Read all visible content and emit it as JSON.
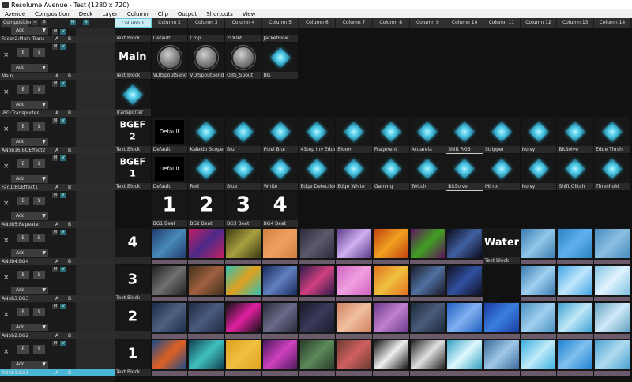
{
  "title": "Resolume Avenue - Test (1280 x 720)",
  "menu": [
    "Avenue",
    "Composition",
    "Deck",
    "Layer",
    "Column",
    "Clip",
    "Output",
    "Shortcuts",
    "View"
  ],
  "header": {
    "composition_label": "Composition",
    "x": "×",
    "b": "B",
    "m": "M",
    "s": "S"
  },
  "columns": [
    "Column 1",
    "Column 2",
    "Column 3",
    "Column 4",
    "Column 5",
    "Column 6",
    "Column 7",
    "Column 8",
    "Column 9",
    "Column 10",
    "Column 11",
    "Column 12",
    "Column 13",
    "Column 14"
  ],
  "active_column": 0,
  "layers": [
    {
      "name": "Fader2:Main Trans",
      "add": "Add"
    },
    {
      "name": "Main",
      "add": "Add"
    },
    {
      "name": "-BG:Transporter-",
      "add": "Add"
    },
    {
      "name": "ANob16:BGEffect2",
      "add": "Add"
    },
    {
      "name": "Fad1:BGEffect1",
      "add": "Add"
    },
    {
      "name": "ANob5:Repeater",
      "add": "Add"
    },
    {
      "name": "ANob4:BG4",
      "add": "Add"
    },
    {
      "name": "ANob3:BG3",
      "add": "Add"
    },
    {
      "name": "ANob2:BG2",
      "add": "Add"
    },
    {
      "name": "ANob1:BG1",
      "add": "Add"
    }
  ],
  "button_labels": {
    "x": "×",
    "b": "B",
    "s": "S",
    "a": "A",
    "bb": "B",
    "m": "M",
    "v": "V",
    "arrow": "▼"
  },
  "rows": [
    {
      "clips": [
        {
          "type": "text",
          "label": "Text Block"
        },
        {
          "type": "empty",
          "label": "Default"
        },
        {
          "type": "empty",
          "label": "Crop"
        },
        {
          "type": "empty",
          "label": "ZOOM"
        },
        {
          "type": "empty",
          "label": "JacketFlow"
        }
      ]
    },
    {
      "clips": [
        {
          "type": "big",
          "text": "Main",
          "label": "Text Block"
        },
        {
          "type": "knob",
          "label": "VDJSpoutSender6..."
        },
        {
          "type": "knob",
          "label": "VDJSpoutSender6..."
        },
        {
          "type": "knob",
          "label": "OBS_Spout"
        },
        {
          "type": "diamond",
          "label": "BG"
        }
      ]
    },
    {
      "clips": [
        {
          "type": "diamond",
          "label": "Transporter"
        }
      ]
    },
    {
      "clips": [
        {
          "type": "big2",
          "text": "BGEF 2",
          "label": "Text Block"
        },
        {
          "type": "default",
          "text": "Default",
          "label": "Default"
        },
        {
          "type": "diamond",
          "label": "Kaleido Scope"
        },
        {
          "type": "diamond",
          "label": "Blur"
        },
        {
          "type": "diamond",
          "label": "Pixel Blur"
        },
        {
          "type": "diamond",
          "label": "4Step Inv Edge"
        },
        {
          "type": "diamond",
          "label": "Bloom"
        },
        {
          "type": "diamond",
          "label": "Fragment"
        },
        {
          "type": "diamond",
          "label": "Acuarela"
        },
        {
          "type": "diamond",
          "label": "Shift RGB"
        },
        {
          "type": "diamond",
          "label": "Stripper"
        },
        {
          "type": "diamond",
          "label": "Noisy"
        },
        {
          "type": "diamond",
          "label": "BitSolve"
        },
        {
          "type": "diamond",
          "label": "Edge Thrsh"
        }
      ]
    },
    {
      "clips": [
        {
          "type": "big2",
          "text": "BGEF 1",
          "label": "Text Block"
        },
        {
          "type": "default",
          "text": "Default",
          "label": "Default"
        },
        {
          "type": "diamond",
          "label": "Red"
        },
        {
          "type": "diamond",
          "label": "Blue"
        },
        {
          "type": "diamond",
          "label": "White"
        },
        {
          "type": "diamond",
          "label": "Edge Detection"
        },
        {
          "type": "diamond",
          "label": "Edge White"
        },
        {
          "type": "diamond",
          "label": "Gaming"
        },
        {
          "type": "diamond",
          "label": "Twitch"
        },
        {
          "type": "diamond",
          "label": "BitSolve",
          "selected": true
        },
        {
          "type": "diamond",
          "label": "Mirror"
        },
        {
          "type": "diamond",
          "label": "Noisy"
        },
        {
          "type": "diamond",
          "label": "Shift Glitch"
        },
        {
          "type": "diamond",
          "label": "Threshold"
        }
      ]
    },
    {
      "clips": [
        {
          "type": "none"
        },
        {
          "type": "num",
          "text": "1",
          "label": "BG1 Beat"
        },
        {
          "type": "num",
          "text": "2",
          "label": "BG2 Beat"
        },
        {
          "type": "num",
          "text": "3",
          "label": "BG3 Beat"
        },
        {
          "type": "num",
          "text": "4",
          "label": "BG4 Beat"
        }
      ]
    },
    {
      "clips": [
        {
          "type": "num",
          "text": "4",
          "label": ""
        },
        {
          "type": "vid",
          "c": "#1e3a6a",
          "c2": "#4a8ab8",
          "label": ""
        },
        {
          "type": "vid",
          "c": "#c42060",
          "c2": "#4a2a8a",
          "label": ""
        },
        {
          "type": "vid",
          "c": "#3a3a10",
          "c2": "#aaa040",
          "label": ""
        },
        {
          "type": "vid",
          "c": "#d08040",
          "c2": "#f0a060",
          "label": ""
        },
        {
          "type": "vid",
          "c": "#2a2a3a",
          "c2": "#5a5a6a",
          "label": ""
        },
        {
          "type": "vid",
          "c": "#5a3a8a",
          "c2": "#d0b0f0",
          "label": ""
        },
        {
          "type": "vid",
          "c": "#c04010",
          "c2": "#f0a020",
          "label": ""
        },
        {
          "type": "vid",
          "c": "#601060",
          "c2": "#40a020",
          "label": ""
        },
        {
          "type": "vid",
          "c": "#0a0a1a",
          "c2": "#4060a0",
          "label": ""
        },
        {
          "type": "big",
          "text": "Water",
          "label": "Text Block"
        },
        {
          "type": "vid",
          "c": "#3a7ab0",
          "c2": "#90c8e8",
          "label": ""
        },
        {
          "type": "vid",
          "c": "#2a80c0",
          "c2": "#60b0f0",
          "label": ""
        },
        {
          "type": "vid",
          "c": "#4a8ac0",
          "c2": "#8ac0e0",
          "label": ""
        }
      ]
    },
    {
      "clips": [
        {
          "type": "num",
          "text": "3",
          "label": "Text Block"
        },
        {
          "type": "vid",
          "c": "#202020",
          "c2": "#707070",
          "label": ""
        },
        {
          "type": "vid",
          "c": "#40301a",
          "c2": "#a06040",
          "label": ""
        },
        {
          "type": "vid",
          "c": "#30c0b0",
          "c2": "#e0a020",
          "label": ""
        },
        {
          "type": "vid",
          "c": "#1a2a5a",
          "c2": "#6080c0",
          "label": ""
        },
        {
          "type": "vid",
          "c": "#301a4a",
          "c2": "#d04080",
          "label": ""
        },
        {
          "type": "vid",
          "c": "#d060c0",
          "c2": "#f0a0e0",
          "label": ""
        },
        {
          "type": "vid",
          "c": "#e07020",
          "c2": "#f0c040",
          "label": ""
        },
        {
          "type": "vid",
          "c": "#1a1a2a",
          "c2": "#5070a0",
          "label": ""
        },
        {
          "type": "vid",
          "c": "#101020",
          "c2": "#3050a0",
          "label": ""
        },
        {
          "type": "none"
        },
        {
          "type": "vid",
          "c": "#3a7ab0",
          "c2": "#a0d0f0",
          "label": ""
        },
        {
          "type": "vid",
          "c": "#40a0e0",
          "c2": "#c0e8ff",
          "label": ""
        },
        {
          "type": "vid",
          "c": "#80c0e0",
          "c2": "#e0f4ff",
          "label": ""
        }
      ]
    },
    {
      "clips": [
        {
          "type": "num",
          "text": "2",
          "label": ""
        },
        {
          "type": "vid",
          "c": "#1a2a4a",
          "c2": "#506080",
          "label": ""
        },
        {
          "type": "vid",
          "c": "#202a40",
          "c2": "#4a5a80",
          "label": ""
        },
        {
          "type": "vid",
          "c": "#101010",
          "c2": "#e020a0",
          "label": ""
        },
        {
          "type": "vid",
          "c": "#2a2a3a",
          "c2": "#6a6a8a",
          "label": ""
        },
        {
          "type": "vid",
          "c": "#1a1a2a",
          "c2": "#3a3a5a",
          "label": ""
        },
        {
          "type": "vid",
          "c": "#d08060",
          "c2": "#f0c0a0",
          "label": ""
        },
        {
          "type": "vid",
          "c": "#6a3a8a",
          "c2": "#c080d0",
          "label": ""
        },
        {
          "type": "vid",
          "c": "#1a2a3a",
          "c2": "#4a5a7a",
          "label": ""
        },
        {
          "type": "vid",
          "c": "#2060c0",
          "c2": "#80b0f0",
          "label": ""
        },
        {
          "type": "vid",
          "c": "#1a3aa0",
          "c2": "#3a80e0",
          "label": ""
        },
        {
          "type": "vid",
          "c": "#4a90c0",
          "c2": "#a0d0f0",
          "label": ""
        },
        {
          "type": "vid",
          "c": "#3aa0d0",
          "c2": "#c0e8f8",
          "label": ""
        },
        {
          "type": "vid",
          "c": "#60a0c0",
          "c2": "#d0eaf8",
          "label": ""
        }
      ]
    },
    {
      "clips": [
        {
          "type": "num",
          "text": "1",
          "label": "Text Block"
        },
        {
          "type": "vid",
          "c": "#1a4a8a",
          "c2": "#e06020",
          "label": ""
        },
        {
          "type": "vid",
          "c": "#104050",
          "c2": "#40c0c0",
          "label": ""
        },
        {
          "type": "vid",
          "c": "#e0a020",
          "c2": "#f0c040",
          "label": ""
        },
        {
          "type": "vid",
          "c": "#4a1a5a",
          "c2": "#d040c0",
          "label": ""
        },
        {
          "type": "vid",
          "c": "#2a3a2a",
          "c2": "#5a8a5a",
          "label": ""
        },
        {
          "type": "vid",
          "c": "#6a3a30",
          "c2": "#d06060",
          "label": ""
        },
        {
          "type": "vid",
          "c": "#101010",
          "c2": "#f0f0f0",
          "label": ""
        },
        {
          "type": "vid",
          "c": "#202020",
          "c2": "#e0e0e0",
          "label": ""
        },
        {
          "type": "vid",
          "c": "#30a0c0",
          "c2": "#e0f8ff",
          "label": ""
        },
        {
          "type": "vid",
          "c": "#3a6a9a",
          "c2": "#a0c8e8",
          "label": ""
        },
        {
          "type": "vid",
          "c": "#3ab0e0",
          "c2": "#c0eaf8",
          "label": ""
        },
        {
          "type": "vid",
          "c": "#2080d0",
          "c2": "#80c0f0",
          "label": ""
        },
        {
          "type": "vid",
          "c": "#4aa0d0",
          "c2": "#b0dcf0",
          "label": ""
        }
      ]
    }
  ]
}
